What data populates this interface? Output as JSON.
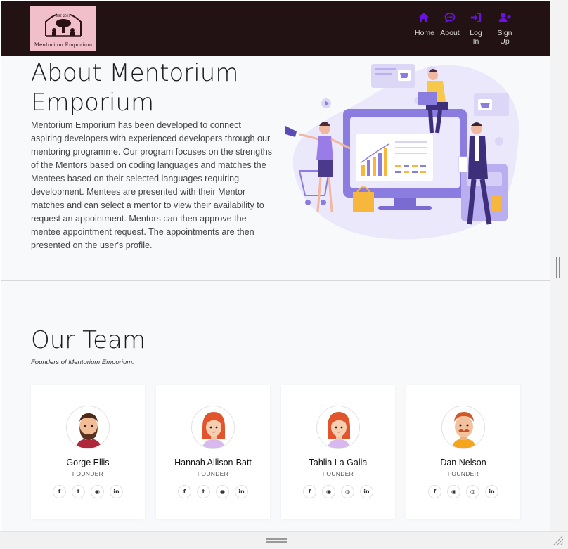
{
  "brand": {
    "logo_text": "Mentorium Emporium",
    "logo_small": "EST. 2023"
  },
  "nav": [
    {
      "key": "home",
      "label": "Home",
      "icon": "home-icon"
    },
    {
      "key": "about",
      "label": "About",
      "icon": "chat-icon"
    },
    {
      "key": "login",
      "label": "Log In",
      "icon": "login-icon"
    },
    {
      "key": "signup",
      "label": "Sign Up",
      "icon": "user-plus-icon"
    }
  ],
  "about": {
    "title": "About Mentorium Emporium",
    "text": "Mentorium Emporium has been developed to connect aspiring developers with experienced developers through our mentoring programme. Our program focuses on the strengths of the Mentors based on coding languages and matches the Mentees based on their selected languages requiring development. Mentees are presented with their Mentor matches and can select a mentor to view their availability to request an appointment. Mentors can then approve the mentee appointment request. The appointments are then presented on the user's profile."
  },
  "team": {
    "title": "Our Team",
    "subtitle": "Founders of Mentorium Emporium.",
    "members": [
      {
        "name": "Gorge Ellis",
        "role": "FOUNDER",
        "socials": [
          "f",
          "t",
          "gh",
          "in"
        ]
      },
      {
        "name": "Hannah Allison-Batt",
        "role": "FOUNDER",
        "socials": [
          "f",
          "t",
          "gh",
          "in"
        ]
      },
      {
        "name": "Tahlia La Galia",
        "role": "FOUNDER",
        "socials": [
          "f",
          "gh",
          "ig",
          "in"
        ]
      },
      {
        "name": "Dan Nelson",
        "role": "FOUNDER",
        "socials": [
          "f",
          "gh",
          "ig",
          "in"
        ]
      }
    ]
  },
  "colors": {
    "navbar": "#231214",
    "accent": "#6a11e6",
    "page_bg": "#f8f9fb",
    "illustration_purple": "#8b7ce0"
  }
}
